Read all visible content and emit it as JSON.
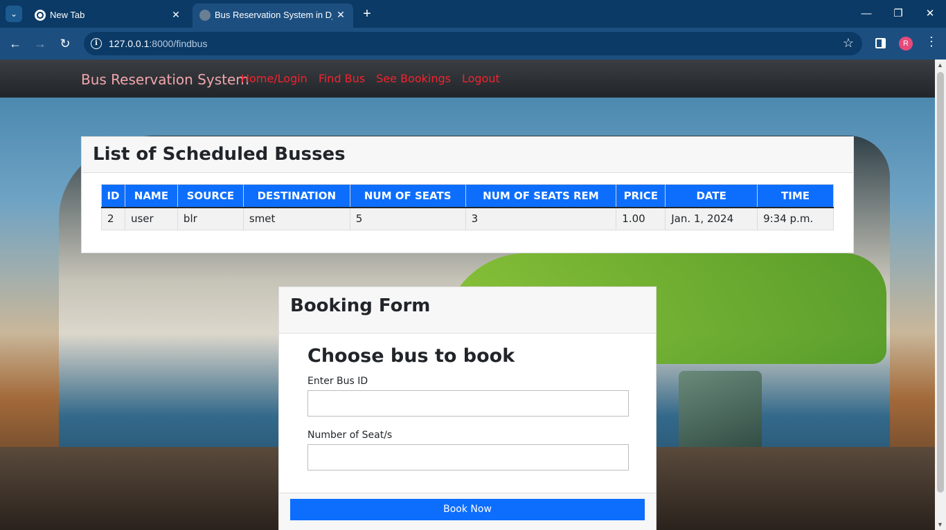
{
  "browser": {
    "tabs": [
      {
        "title": "New Tab",
        "active": false
      },
      {
        "title": "Bus Reservation System in Django",
        "active": true
      }
    ],
    "url_host": "127.0.0.1",
    "url_path": ":8000/findbus",
    "profile_initial": "R"
  },
  "site": {
    "brand": "Bus Reservation System",
    "nav": [
      "Home/Login",
      "Find Bus",
      "See Bookings",
      "Logout"
    ],
    "colors": {
      "nav_link": "#f5222d",
      "brand": "#f0a6ac",
      "primary": "#0d6efd"
    }
  },
  "bus_list": {
    "title": "List of Scheduled Busses",
    "columns": [
      "ID",
      "NAME",
      "SOURCE",
      "DESTINATION",
      "NUM OF SEATS",
      "NUM OF SEATS REM",
      "PRICE",
      "DATE",
      "TIME"
    ],
    "rows": [
      [
        "2",
        "user",
        "blr",
        "smet",
        "5",
        "3",
        "1.00",
        "Jan. 1, 2024",
        "9:34 p.m."
      ]
    ]
  },
  "booking_form": {
    "title": "Booking Form",
    "heading": "Choose bus to book",
    "bus_id_label": "Enter Bus ID",
    "bus_id_value": "",
    "seats_label": "Number of Seat/s",
    "seats_value": "",
    "submit_label": "Book Now"
  }
}
